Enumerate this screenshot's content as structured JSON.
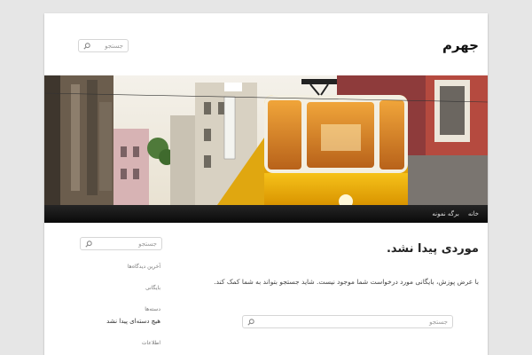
{
  "header": {
    "site_title": "جهرم",
    "search_placeholder": "جستجو"
  },
  "nav": {
    "items": [
      "خانه",
      "برگه نمونه"
    ]
  },
  "main": {
    "title": "موردی پیدا نشد.",
    "message": "با عرض پوزش، بایگانی مورد درخواست شما موجود نیست. شاید جستجو بتواند به شما کمک کند.",
    "search_placeholder": "جستجو"
  },
  "sidebar": {
    "search_placeholder": "جستجو",
    "widgets": {
      "recent_comments": "آخرین دیدگاه‌ها",
      "archives": "بایگانی",
      "categories": "دسته‌ها",
      "categories_empty": "هیچ دسته‌ای پیدا نشد",
      "meta": "اطلاعات"
    }
  },
  "colors": {
    "page_bg": "#e6e6e6",
    "nav_bg": "#1a1a1a",
    "tram_yellow": "#f2b705"
  }
}
